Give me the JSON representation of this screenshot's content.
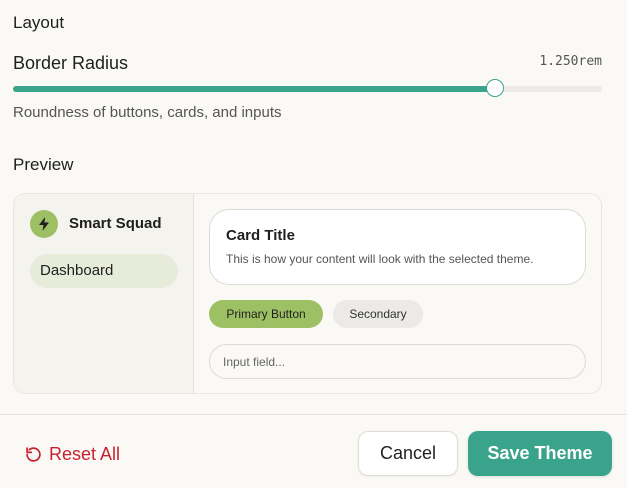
{
  "layout": {
    "title": "Layout"
  },
  "border_radius": {
    "label": "Border Radius",
    "value": "1.250rem",
    "slider_fraction": 0.82,
    "description": "Roundness of buttons, cards, and inputs"
  },
  "preview": {
    "title": "Preview",
    "sidebar": {
      "brand_icon": "lightning-icon",
      "brand_name": "Smart Squad",
      "nav_items": [
        {
          "label": "Dashboard"
        }
      ]
    },
    "card": {
      "title": "Card Title",
      "text": "This is how your content will look with the selected theme."
    },
    "primary_button": "Primary Button",
    "secondary_button": "Secondary",
    "input_placeholder": "Input field..."
  },
  "footer": {
    "reset_icon": "rotate-ccw-icon",
    "reset_label": "Reset All",
    "cancel_label": "Cancel",
    "save_label": "Save Theme"
  },
  "colors": {
    "accent": "#3aa38b",
    "primary_button": "#9ec064",
    "nav_active": "#e6ecd9",
    "reset": "#c8222f"
  }
}
